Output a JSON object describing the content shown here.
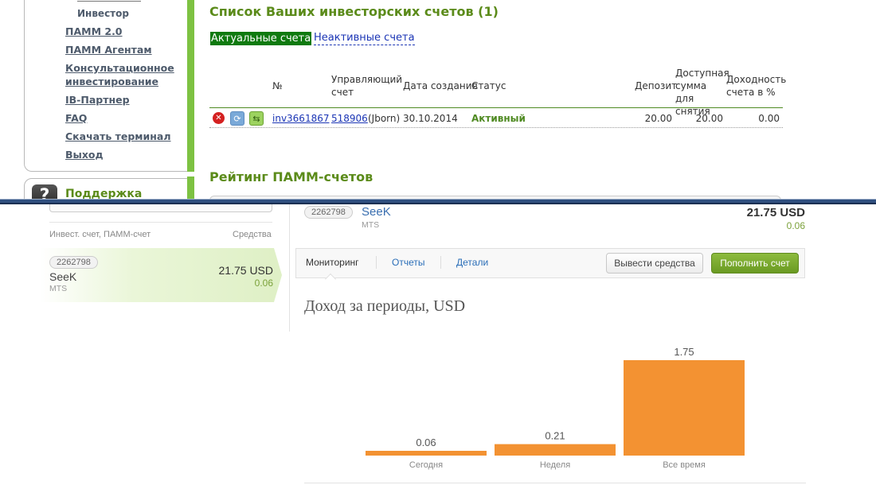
{
  "top": {
    "sidebar": {
      "sub_item": "Инвестор",
      "menu": [
        "ПАММ 2.0",
        "ПАММ Агентам",
        "Консультационное инвестирование",
        "IB-Партнер",
        "FAQ",
        "Скачать терминал",
        "Выход"
      ],
      "support": "Поддержка",
      "support_icon": "?"
    },
    "list_title": "Список Ваших инвесторских счетов (1)",
    "tabs": {
      "active": "Актуальные счета",
      "inactive": "Неактивные счета"
    },
    "table": {
      "headers": {
        "num": "№",
        "managing": "Управляющий счет",
        "created": "Дата создания",
        "status": "Статус",
        "deposit": "Депозит",
        "available": "Доступная сумма для снятия",
        "yield": "Доходность счета в %"
      },
      "rows": [
        {
          "num": "inv3661867",
          "managing_id": "518906",
          "managing_name": "(Jborn)",
          "created": "30.10.2014",
          "status": "Активный",
          "deposit": "20.00",
          "available": "20.00",
          "yield": "0.00"
        }
      ]
    },
    "rating_title": "Рейтинг ПАММ-счетов"
  },
  "bottom": {
    "sidebar": {
      "header_left": "Инвест. счет, ПАММ-счет",
      "header_right": "Средства",
      "item": {
        "id": "2262798",
        "name": "SeeK",
        "sub": "MTS",
        "amount": "21.75 USD",
        "change": "0.06"
      }
    },
    "account": {
      "id": "2262798",
      "name": "SeeK",
      "sub": "MTS",
      "amount": "21.75 USD",
      "change": "0.06"
    },
    "tabs": [
      "Мониторинг",
      "Отчеты",
      "Детали"
    ],
    "buttons": {
      "withdraw": "Вывести средства",
      "deposit": "Пополнить счет"
    },
    "chart_title": "Доход за периоды, USD"
  },
  "colors": {
    "bar": "#f39232",
    "accent_green": "#5b8b1a",
    "link_blue": "#1b35b5"
  },
  "chart_data": {
    "type": "bar",
    "title": "Доход за периоды, USD",
    "categories": [
      "Сегодня",
      "Неделя",
      "Все время"
    ],
    "values": [
      0.06,
      0.21,
      1.75
    ],
    "data_labels": [
      "0.06",
      "0.21",
      "1.75"
    ],
    "ylim": [
      0,
      1.75
    ],
    "grid": false
  }
}
